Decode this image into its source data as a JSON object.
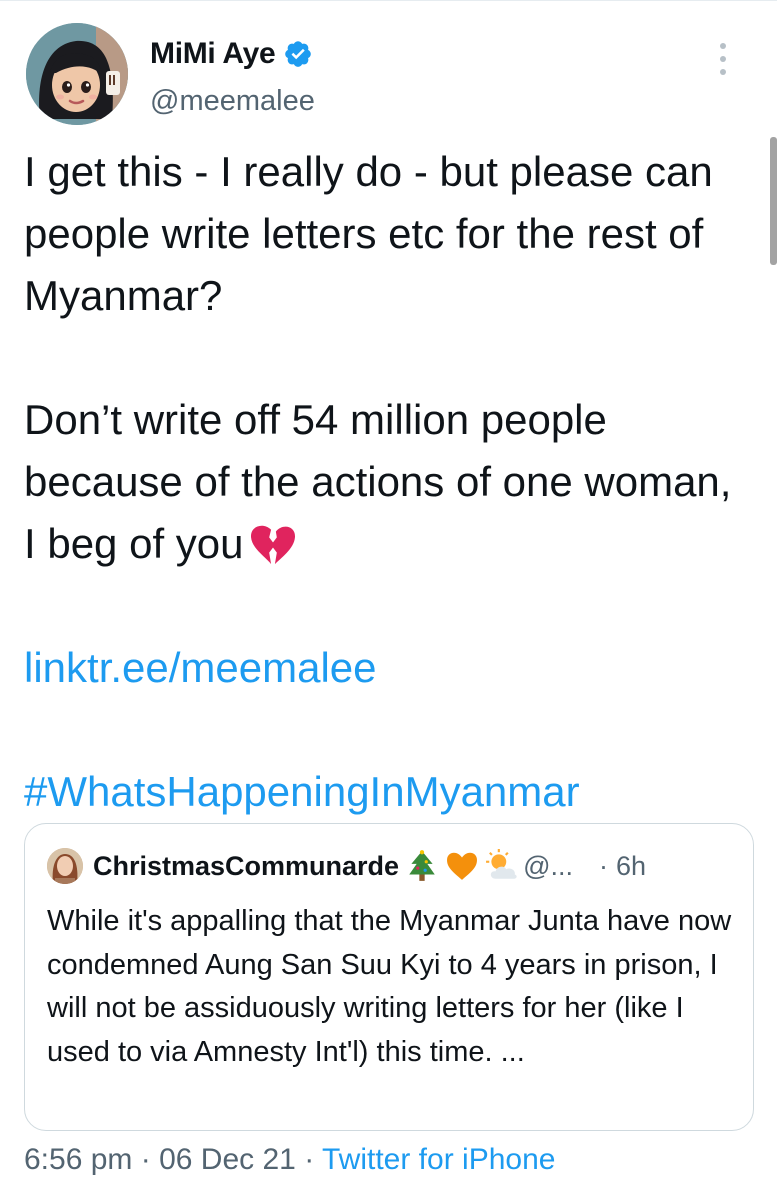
{
  "author": {
    "name": "MiMi Aye",
    "handle": "@meemalee",
    "verified": true
  },
  "tweet": {
    "paragraph1": "I get this - I really do - but please can people write letters etc for the rest of Myanmar?",
    "paragraph2": "Don’t write off 54 million people because of the actions of one woman, I beg of you",
    "paragraph2_emoji": "broken-heart-icon",
    "link": "linktr.ee/meemalee",
    "hashtag": "#WhatsHappeningInMyanmar"
  },
  "quoted_tweet": {
    "name": "ChristmasCommunarde",
    "name_emojis": [
      "christmas-tree-icon",
      "orange-heart-icon",
      "sun-behind-cloud-icon"
    ],
    "handle": "@...",
    "separator": "·",
    "time": "6h",
    "text": "While it's appalling that the Myanmar Junta have now condemned Aung San Suu Kyi to 4 years in prison, I will not be assiduously writing letters for her (like I used to via Amnesty Int'l) this time. ..."
  },
  "footer": {
    "time": "6:56 pm",
    "sep1": "·",
    "date": "06 Dec 21",
    "sep2": "·",
    "source": "Twitter for iPhone"
  },
  "colors": {
    "accent": "#1d9bf0",
    "secondary_text": "#536471",
    "primary_text": "#0f1419",
    "border": "#cfd9de"
  }
}
